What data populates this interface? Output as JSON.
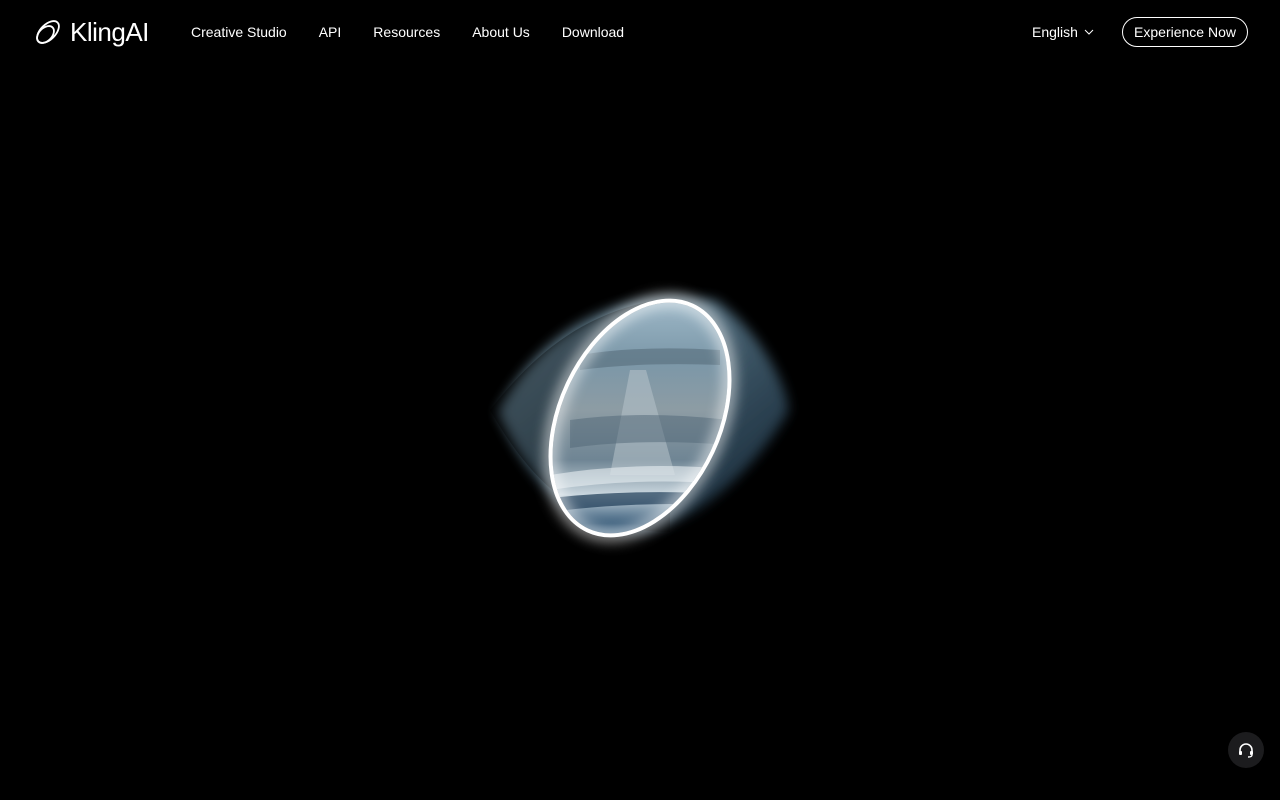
{
  "brand": {
    "name": "KlingAI",
    "logo_icon": "kling-orbit-logo-icon"
  },
  "nav": {
    "items": [
      {
        "label": "Creative Studio"
      },
      {
        "label": "API"
      },
      {
        "label": "Resources"
      },
      {
        "label": "About Us"
      },
      {
        "label": "Download"
      }
    ]
  },
  "language": {
    "selected": "English",
    "icon": "chevron-down-icon"
  },
  "cta": {
    "label": "Experience Now"
  },
  "hero": {
    "visual": "glowing-portal-ring"
  },
  "support": {
    "icon": "headset-icon"
  },
  "colors": {
    "background": "#000000",
    "text": "#ffffff",
    "ring_glow": "#ffffff",
    "portal_tint": "#7fa3b8",
    "support_bg": "#1c1c1e"
  }
}
